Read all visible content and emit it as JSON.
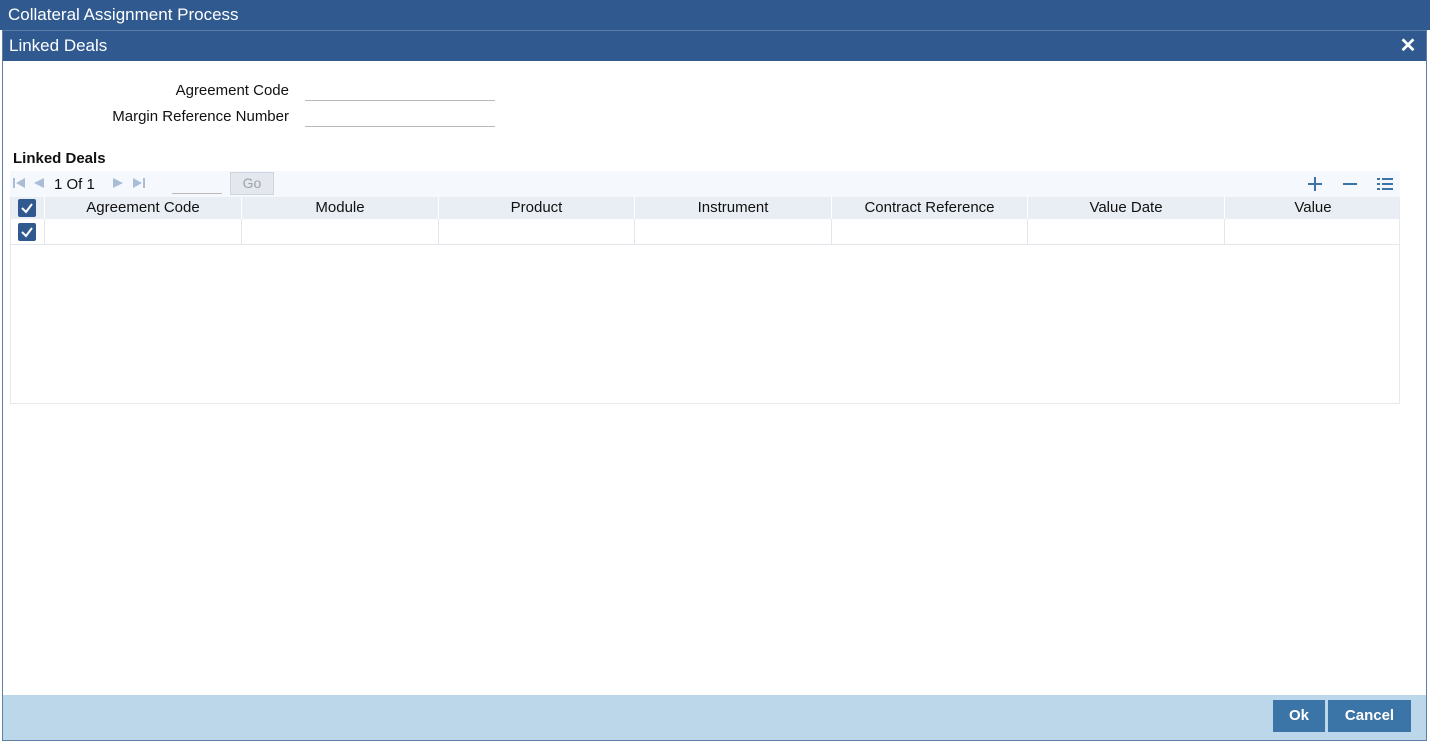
{
  "window": {
    "title": "Collateral Assignment Process"
  },
  "dialog": {
    "title": "Linked Deals",
    "close_icon": "close-icon"
  },
  "form": {
    "agreement_code": {
      "label": "Agreement Code",
      "value": ""
    },
    "margin_reference_number": {
      "label": "Margin Reference Number",
      "value": ""
    }
  },
  "linked_deals": {
    "section_title": "Linked Deals",
    "pagination": {
      "current": "1",
      "of_label": "Of",
      "total": "1",
      "go_label": "Go",
      "page_input": ""
    },
    "toolbar_icons": [
      "add-row-icon",
      "delete-row-icon",
      "single-view-icon"
    ],
    "columns": [
      "Agreement Code",
      "Module",
      "Product",
      "Instrument",
      "Contract Reference",
      "Value Date",
      "Value"
    ],
    "rows": [
      {
        "checked": true,
        "cells": [
          "",
          "",
          "",
          "",
          "",
          "",
          ""
        ]
      }
    ]
  },
  "footer": {
    "ok_label": "Ok",
    "cancel_label": "Cancel"
  },
  "colors": {
    "title_bar": "#305a8f",
    "footer": "#bcd6ea",
    "button": "#3b74a7"
  }
}
